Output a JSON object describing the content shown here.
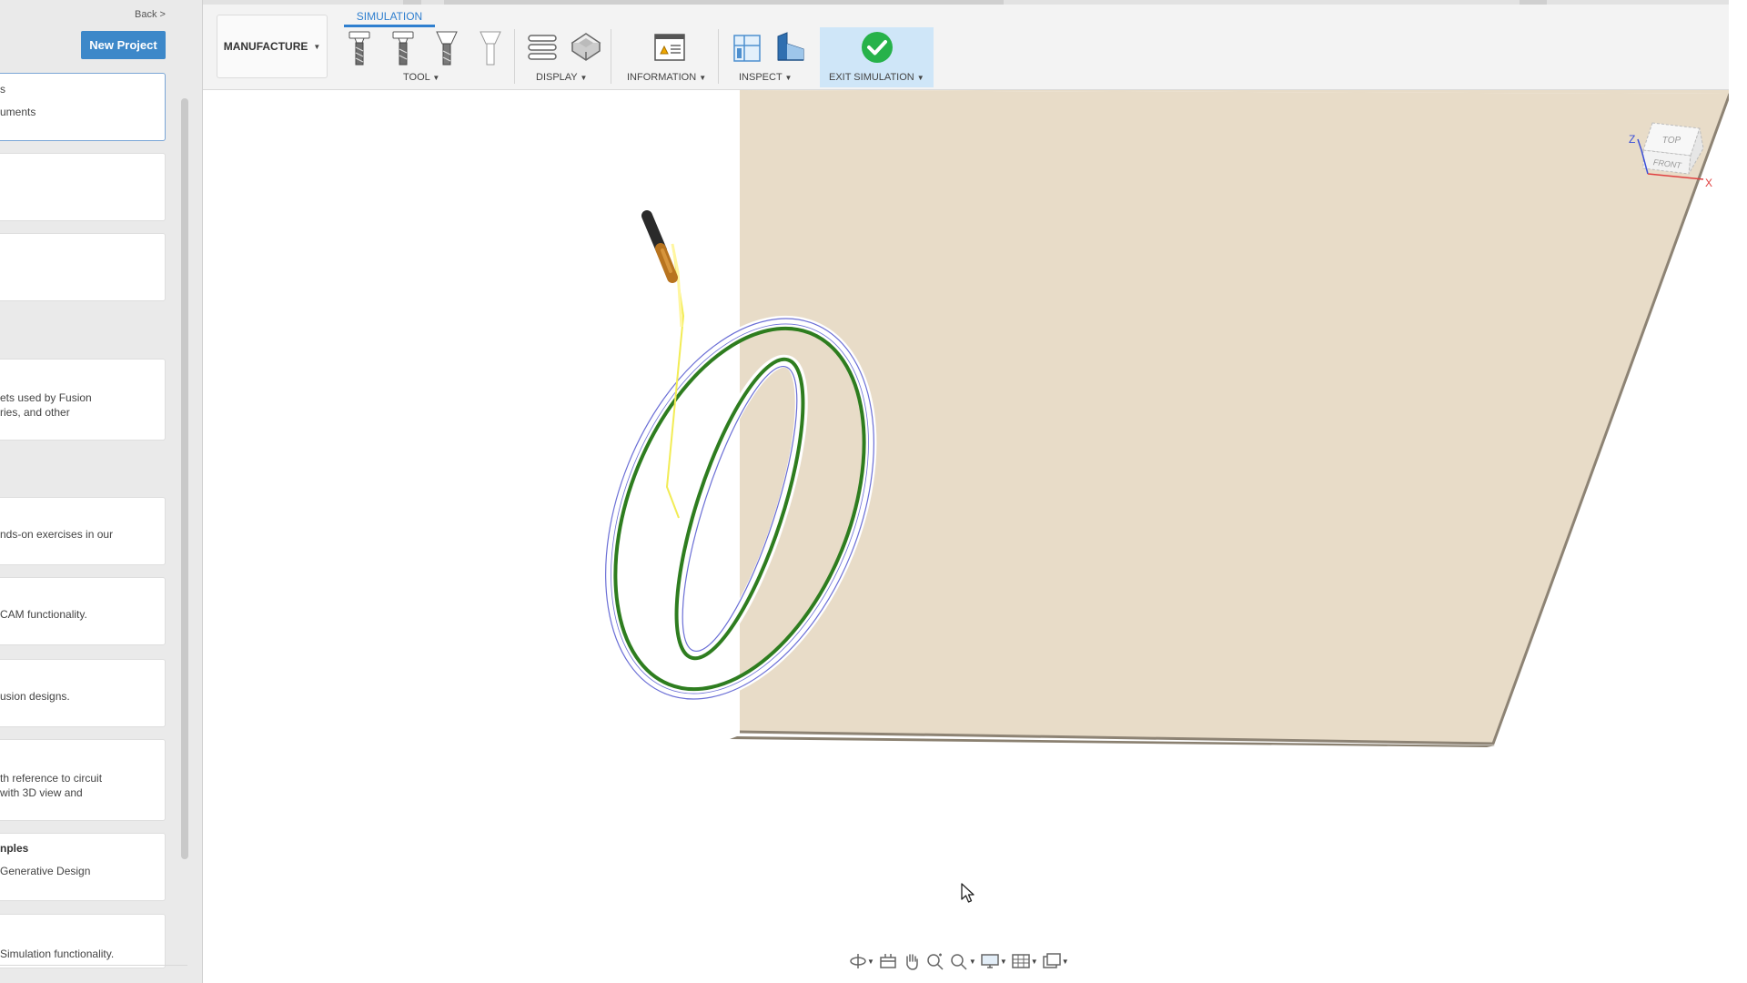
{
  "left_panel": {
    "back_label": "Back >",
    "new_project_label": "New Project",
    "cards": [
      {
        "lines": [
          "s",
          "uments"
        ]
      },
      {
        "lines": []
      },
      {
        "lines": []
      },
      {
        "lines": [
          "ets used by Fusion",
          "ries, and other"
        ]
      },
      {
        "lines": [
          "nds-on exercises in our"
        ]
      },
      {
        "lines": [
          "CAM functionality."
        ]
      },
      {
        "lines": [
          "usion designs."
        ]
      },
      {
        "lines": [
          "th reference to circuit",
          "with 3D view and"
        ]
      },
      {
        "title": "nples",
        "lines": [
          "Generative Design"
        ]
      },
      {
        "lines": [
          "Simulation functionality."
        ]
      }
    ]
  },
  "toolbar": {
    "workspace_label": "MANUFACTURE",
    "active_tab_label": "SIMULATION",
    "groups": {
      "tool": "TOOL",
      "display": "DISPLAY",
      "information": "INFORMATION",
      "inspect": "INSPECT",
      "exit": "EXIT SIMULATION"
    }
  },
  "view_cube": {
    "top_label": "TOP",
    "front_label": "FRONT",
    "axis_z": "Z",
    "axis_x": "X"
  },
  "colors": {
    "accent": "#2f7fcf",
    "new_project_bg": "#3d88c9",
    "stock": "#e8dcc8",
    "toolpath": "#2e7d1f",
    "exit_check": "#27b24a"
  }
}
